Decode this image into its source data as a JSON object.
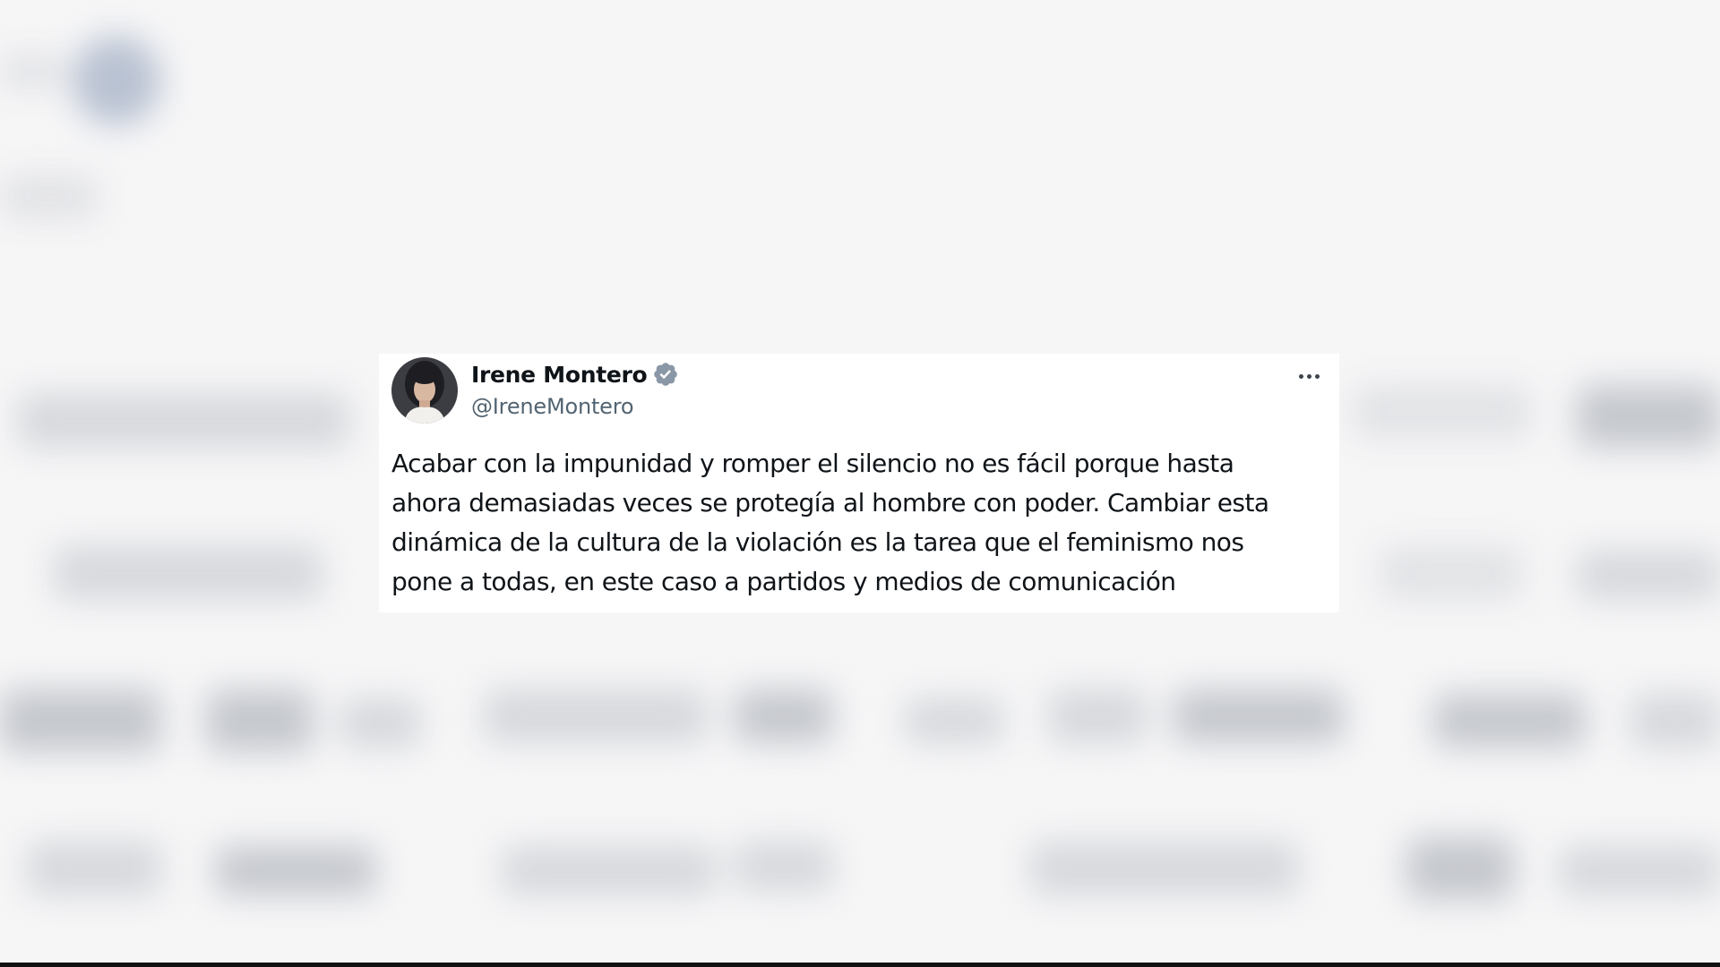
{
  "tweet": {
    "author": {
      "display_name": "Irene Montero",
      "handle": "@IreneMontero",
      "verified": true,
      "avatar_icon": "profile-photo"
    },
    "more_icon": "ellipsis-icon",
    "text_lines": [
      "Acabar con la impunidad y romper el silencio no es fácil porque hasta",
      "ahora demasiadas veces se protegía al hombre con poder. Cambiar esta",
      "dinámica de la cultura de la violación es la tarea que el feminismo nos",
      "pone a todas, en este caso a partidos y medios de comunicación"
    ]
  },
  "colors": {
    "card_background": "#ffffff",
    "page_background": "#f6f6f7",
    "name_color": "#0f1419",
    "handle_color": "#536471",
    "verified_badge": "#8a97a6"
  }
}
